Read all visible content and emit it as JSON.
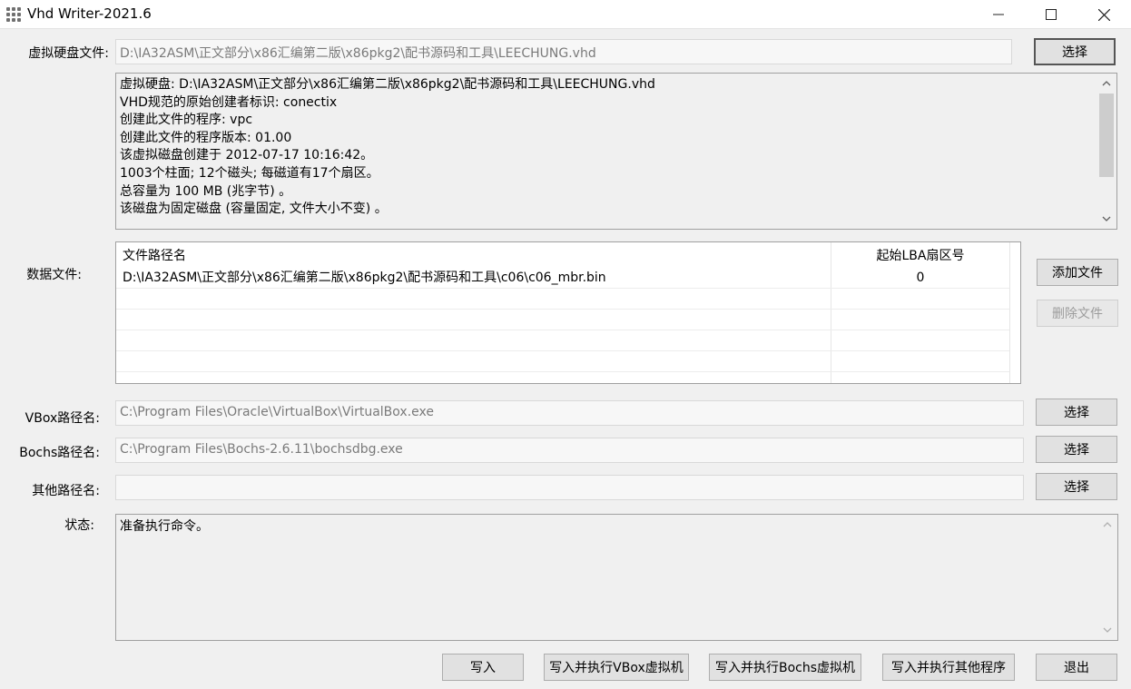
{
  "window": {
    "title": "Vhd Writer-2021.6",
    "minimize_icon": "minimize-icon",
    "maximize_icon": "maximize-icon",
    "close_icon": "close-icon"
  },
  "vhd": {
    "label": "虚拟硬盘文件:",
    "path": "D:\\IA32ASM\\正文部分\\x86汇编第二版\\x86pkg2\\配书源码和工具\\LEECHUNG.vhd",
    "select_label": "选择"
  },
  "info": {
    "lines": [
      "虚拟硬盘:  D:\\IA32ASM\\正文部分\\x86汇编第二版\\x86pkg2\\配书源码和工具\\LEECHUNG.vhd",
      "VHD规范的原始创建者标识:  conectix",
      "创建此文件的程序: vpc",
      "创建此文件的程序版本: 01.00",
      "该虚拟磁盘创建于 2012-07-17 10:16:42。",
      "1003个柱面; 12个磁头; 每磁道有17个扇区。",
      "总容量为 100 MB (兆字节) 。",
      "该磁盘为固定磁盘 (容量固定, 文件大小不变) 。"
    ]
  },
  "datafiles": {
    "label": "数据文件:",
    "columns": [
      "文件路径名",
      "起始LBA扇区号"
    ],
    "rows": [
      [
        "D:\\IA32ASM\\正文部分\\x86汇编第二版\\x86pkg2\\配书源码和工具\\c06\\c06_mbr.bin",
        "0"
      ],
      [
        "",
        ""
      ],
      [
        "",
        ""
      ],
      [
        "",
        ""
      ],
      [
        "",
        ""
      ]
    ],
    "add_label": "添加文件",
    "delete_label": "删除文件"
  },
  "vbox": {
    "label": "VBox路径名:",
    "path": "C:\\Program Files\\Oracle\\VirtualBox\\VirtualBox.exe",
    "select_label": "选择"
  },
  "bochs": {
    "label": "Bochs路径名:",
    "path": "C:\\Program Files\\Bochs-2.6.11\\bochsdbg.exe",
    "select_label": "选择"
  },
  "other": {
    "label": "其他路径名:",
    "path": "",
    "select_label": "选择"
  },
  "status": {
    "label": "状态:",
    "text": "准备执行命令。"
  },
  "actions": {
    "write": "写入",
    "write_vbox": "写入并执行VBox虚拟机",
    "write_bochs": "写入并执行Bochs虚拟机",
    "write_other": "写入并执行其他程序",
    "exit": "退出"
  }
}
